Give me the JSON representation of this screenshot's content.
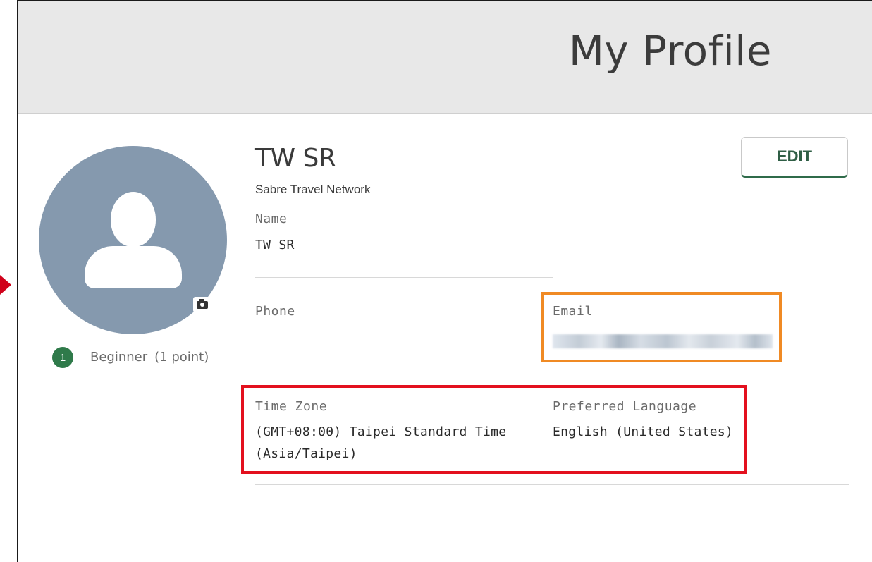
{
  "header": {
    "title": "My Profile"
  },
  "profile": {
    "display_name": "TW SR",
    "company": "Sabre Travel Network",
    "edit_label": "EDIT",
    "level": {
      "number": "1",
      "name": "Beginner",
      "points": "(1 point)"
    }
  },
  "fields": {
    "name": {
      "label": "Name",
      "value": "TW SR"
    },
    "phone": {
      "label": "Phone",
      "value": ""
    },
    "email": {
      "label": "Email",
      "value": ""
    },
    "time_zone": {
      "label": "Time Zone",
      "value_line1": "(GMT+08:00) Taipei Standard Time",
      "value_line2": "(Asia/Taipei)"
    },
    "language": {
      "label": "Preferred Language",
      "value": "English (United States)"
    }
  },
  "colors": {
    "header_bg": "#e8e8e8",
    "avatar_bg": "#8599ae",
    "level_badge": "#2f7a4a",
    "edit_accent": "#2f6b4a",
    "highlight_orange": "#f08a24",
    "highlight_red": "#e3101e"
  },
  "icons": {
    "avatar": "user-silhouette-icon",
    "camera": "camera-icon"
  }
}
